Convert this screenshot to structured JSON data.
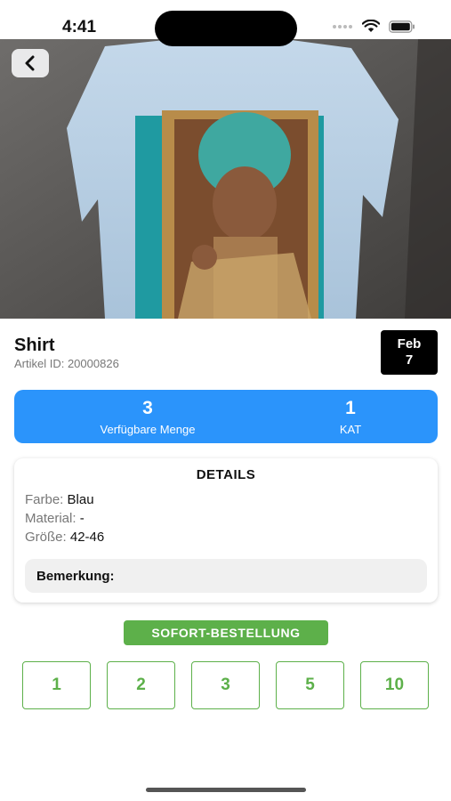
{
  "status_bar": {
    "time": "4:41"
  },
  "product": {
    "title": "Shirt",
    "article_id": "Artikel ID: 20000826",
    "date_month": "Feb",
    "date_day": "7"
  },
  "stats": {
    "quantity_value": "3",
    "quantity_label": "Verfügbare Menge",
    "kat_value": "1",
    "kat_label": "KAT"
  },
  "details": {
    "title": "DETAILS",
    "color_key": "Farbe:",
    "color_value": "Blau",
    "material_key": "Material:",
    "material_value": "-",
    "size_key": "Größe:",
    "size_value": "42-46",
    "remark_label": "Bemerkung:"
  },
  "order": {
    "label": "SOFORT-BESTELLUNG",
    "quantities": [
      "1",
      "2",
      "3",
      "5",
      "10"
    ]
  },
  "colors": {
    "accent_blue": "#2b94fb",
    "accent_green": "#5db04a",
    "badge_black": "#000000"
  }
}
